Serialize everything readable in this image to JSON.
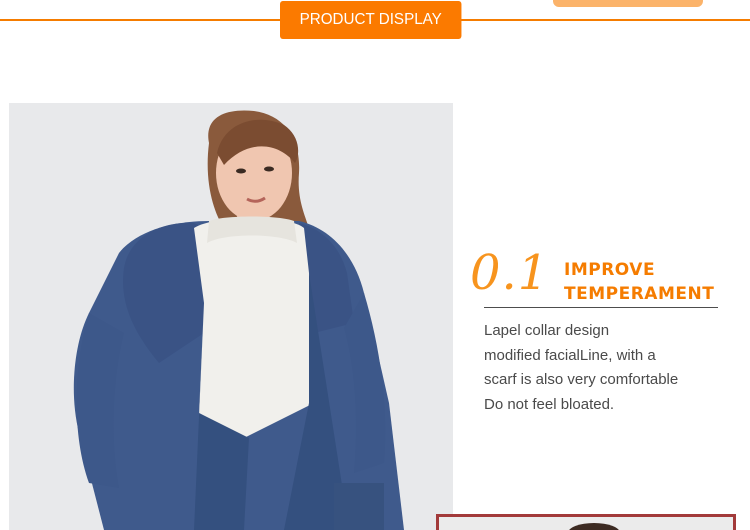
{
  "section_header": {
    "title": "PRODUCT DISPLAY",
    "accent_color": "#fb7a00"
  },
  "feature": {
    "number": "0.1",
    "title_line1": "IMPROVE",
    "title_line2": "TEMPERAMENT",
    "description": [
      "Lapel collar design",
      "modified facialLine, with a",
      "scarf is also very comfortable",
      "Do not feel bloated."
    ],
    "number_color": "#f7941e",
    "title_color": "#f57c00"
  },
  "product_photo": {
    "subject": "model-in-blue-hooded-coat-icon"
  }
}
